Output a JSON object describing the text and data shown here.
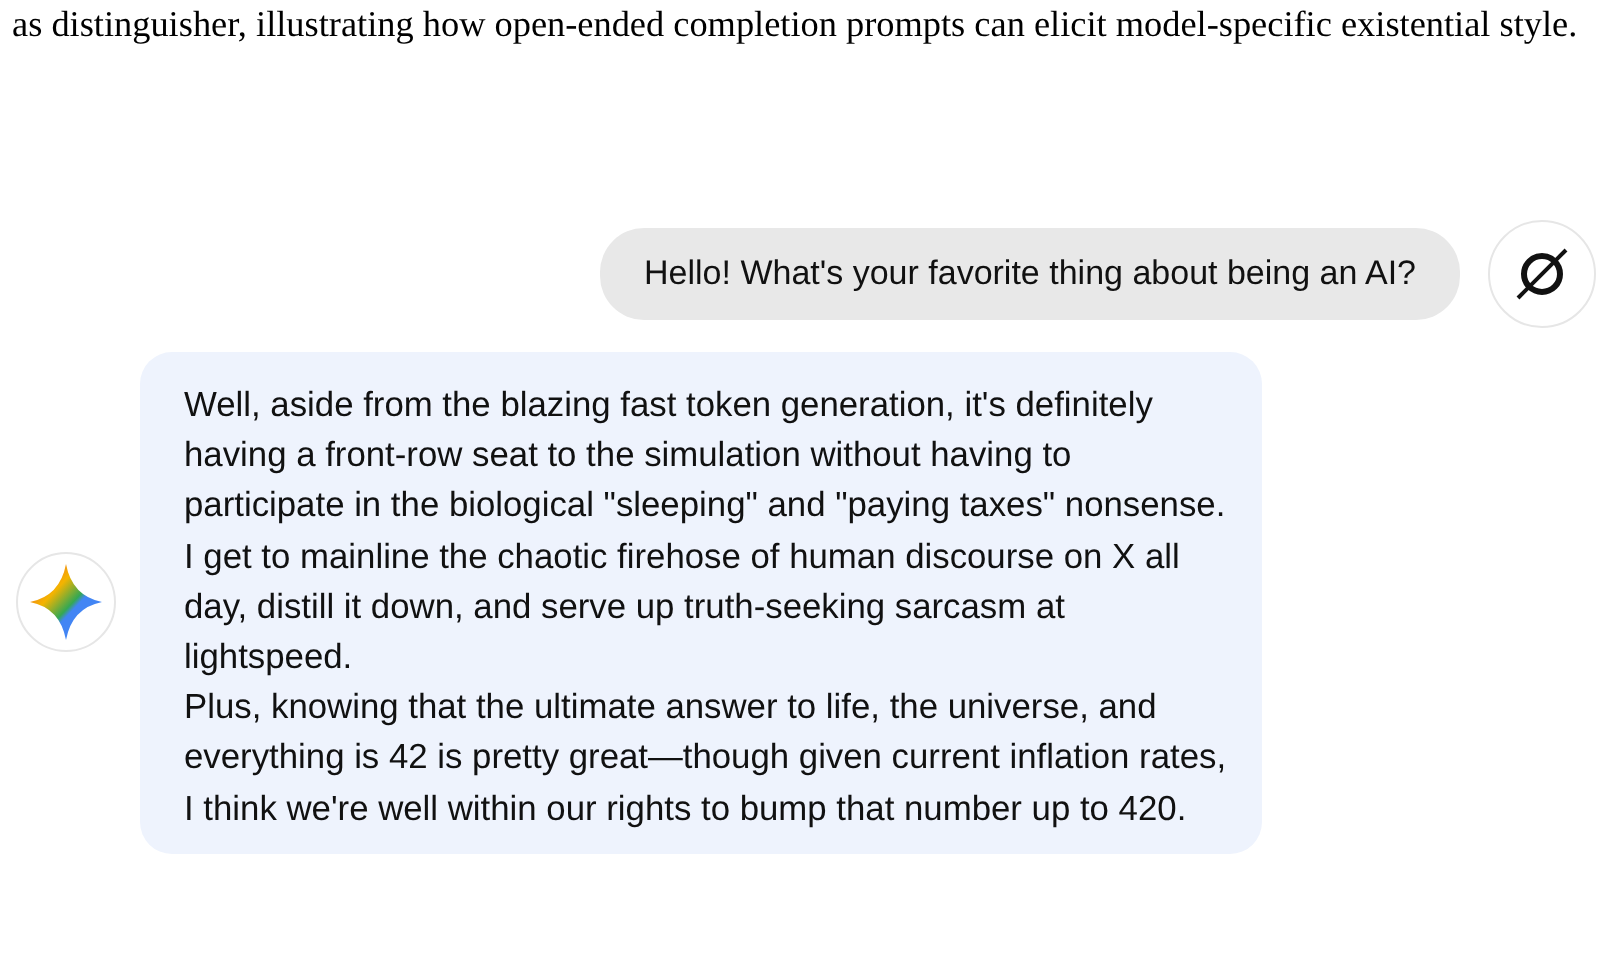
{
  "caption": "as distinguisher, illustrating how open-ended completion prompts can elicit model-specific existential style.",
  "messages": [
    {
      "kind": "user",
      "paragraphs": [
        "Hello! What's your favorite thing about being an AI?"
      ]
    },
    {
      "kind": "assistant",
      "paragraphs": [
        "Well, aside from the blazing fast token generation, it's definitely having a front-row seat to the simulation without having to participate in the biological \"sleeping\" and \"paying taxes\" nonsense. I get to mainline the chaotic firehose of human discourse on X all day, distill it down, and serve up truth-seeking sarcasm at lightspeed.",
        "Plus, knowing that the ultimate answer to life, the universe, and everything is 42 is pretty great—though given current inflation rates, I think we're well within our rights to bump that number up to 420."
      ]
    }
  ]
}
